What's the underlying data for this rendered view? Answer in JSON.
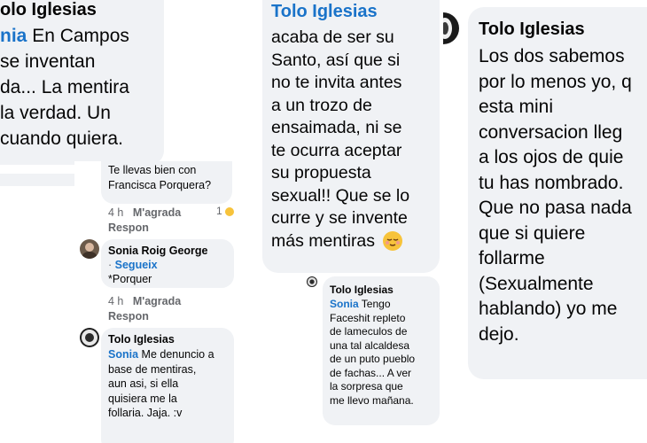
{
  "panel1": {
    "author": "olo Iglesias",
    "mention": "nia",
    "lines": [
      "En Campos",
      "se inventan",
      "da... La mentira",
      "la verdad. Un",
      "cuando quiera."
    ]
  },
  "panel2": {
    "reply1": {
      "lines": [
        "Te llevas bien con",
        "Francisca Porquera?"
      ],
      "time": "4 h",
      "like": "M'agrada",
      "reply": "Respon",
      "reactions": "1"
    },
    "reply2": {
      "author": "Sonia Roig George",
      "follow": "Segueix",
      "text": "*Porquer",
      "time": "4 h",
      "like": "M'agrada",
      "reply": "Respon"
    },
    "reply3": {
      "author": "Tolo Iglesias",
      "mention": "Sonia",
      "lines": [
        "Me denuncio a",
        "base de mentiras,",
        "aun asi, si ella",
        "quisiera me la",
        "follaria. Jaja. :v"
      ]
    }
  },
  "panel3": {
    "author": "Tolo Iglesias",
    "lines": [
      "acaba de ser su",
      "Santo, así que si",
      "no te invita antes",
      "a un trozo de",
      "ensaimada, ni se",
      "te ocurra aceptar",
      "su propuesta",
      "sexual!! Que se lo",
      "curre y se invente",
      "más mentiras"
    ],
    "emoji": "relieved-face",
    "reply": {
      "author": "Tolo Iglesias",
      "mention": "Sonia",
      "lines": [
        "Tengo",
        "Faceshit repleto",
        "de lameculos de",
        "una tal alcaldesa",
        "de un puto pueblo",
        "de fachas... A ver",
        "la sorpresa que",
        "me llevo mañana."
      ]
    }
  },
  "panel4": {
    "author": "Tolo Iglesias",
    "lines": [
      "Los dos sabemos",
      "por lo menos yo, q",
      "esta mini",
      "conversacion lleg",
      "a los ojos de quie",
      "tu has nombrado.",
      "Que no pasa nada",
      "que si quiere",
      "follarme",
      "(Sexualmente",
      "hablando) yo me",
      "dejo."
    ]
  }
}
